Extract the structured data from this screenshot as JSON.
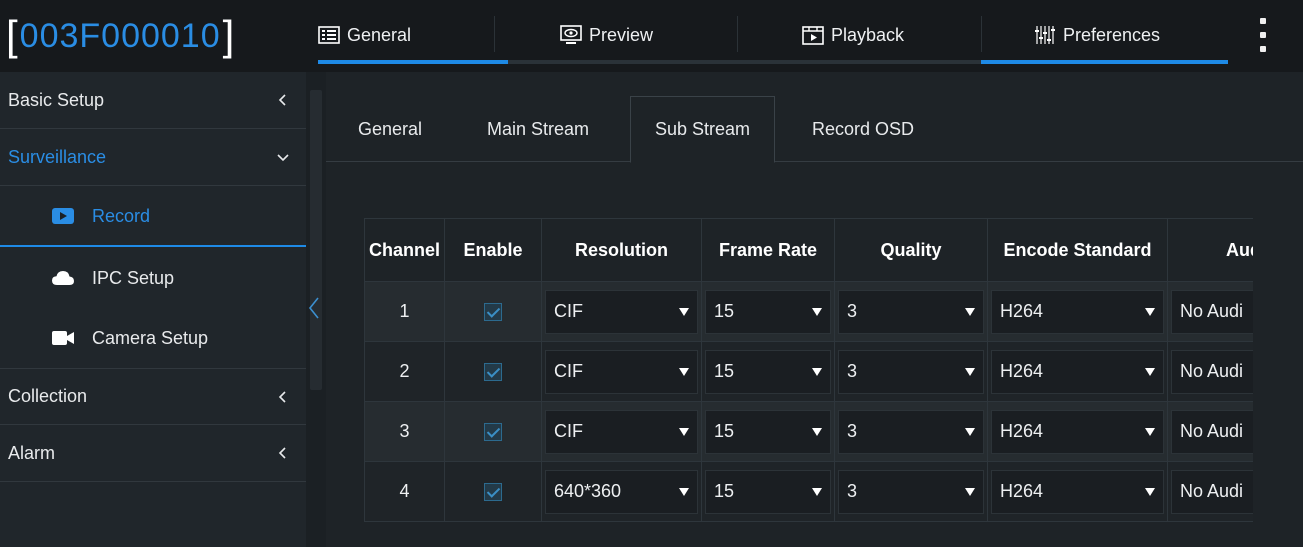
{
  "device": {
    "id": "003F000010"
  },
  "main_tabs": [
    {
      "label": "General",
      "icon": "general-icon"
    },
    {
      "label": "Preview",
      "icon": "preview-icon"
    },
    {
      "label": "Playback",
      "icon": "playback-icon"
    },
    {
      "label": "Preferences",
      "icon": "preferences-icon",
      "active": true
    }
  ],
  "sidebar": {
    "basic_setup": "Basic Setup",
    "surveillance": "Surveillance",
    "record": "Record",
    "ipc_setup": "IPC Setup",
    "camera_setup": "Camera Setup",
    "collection": "Collection",
    "alarm": "Alarm"
  },
  "sub_tabs": [
    {
      "label": "General"
    },
    {
      "label": "Main Stream"
    },
    {
      "label": "Sub Stream",
      "active": true
    },
    {
      "label": "Record OSD"
    }
  ],
  "table": {
    "headers": [
      "Channel",
      "Enable",
      "Resolution",
      "Frame Rate",
      "Quality",
      "Encode Standard",
      "Aud"
    ],
    "rows": [
      {
        "channel": "1",
        "enabled": true,
        "resolution": "CIF",
        "frame_rate": "15",
        "quality": "3",
        "encode": "H264",
        "audio": "No Audi"
      },
      {
        "channel": "2",
        "enabled": true,
        "resolution": "CIF",
        "frame_rate": "15",
        "quality": "3",
        "encode": "H264",
        "audio": "No Audi"
      },
      {
        "channel": "3",
        "enabled": true,
        "resolution": "CIF",
        "frame_rate": "15",
        "quality": "3",
        "encode": "H264",
        "audio": "No Audi"
      },
      {
        "channel": "4",
        "enabled": true,
        "resolution": "640*360",
        "frame_rate": "15",
        "quality": "3",
        "encode": "H264",
        "audio": "No Audi"
      }
    ]
  },
  "colors": {
    "accent": "#1e8ae6",
    "background": "#1b2024",
    "sidebar": "#20262b"
  }
}
